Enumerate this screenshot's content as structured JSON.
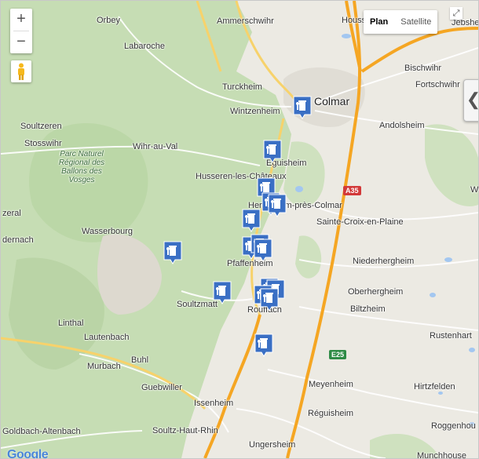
{
  "controls": {
    "zoom_in": "+",
    "zoom_out": "−",
    "map_types": [
      "Plan",
      "Satellite"
    ],
    "active_map_type": "Plan",
    "expand": "❮",
    "fullscreen": "⤢"
  },
  "colors": {
    "forest": "#c6ddb4",
    "plain": "#eceae3",
    "motorway": "#f5a623",
    "marker": "#3a6fc4"
  },
  "labels": {
    "houssen": "Houss",
    "jebsheim": "Jebshei",
    "orbey": "Orbey",
    "ammerschwihr": "Ammerschwihr",
    "labaroche": "Labaroche",
    "bischwihr": "Bischwihr",
    "fortschwihr": "Fortschwihr",
    "turckheim": "Turckheim",
    "colmar": "Colmar",
    "wintzenheim": "Wintzenheim",
    "andolsheim": "Andolsheim",
    "soultzeren": "Soultzeren",
    "stosswihr": "Stosswihr",
    "wihr": "Wihr-au-Val",
    "park": "Parc Naturel Régional des Ballons des Vosges",
    "eguisheim": "Eguisheim",
    "husseren": "Husseren-les-Châteaux",
    "herrlisheim": "Herrlisheim-près-Colmar",
    "a35": "A35",
    "zeral": "zeral",
    "sainte_croix": "Sainte-Croix-en-Plaine",
    "dernach": "dernach",
    "wasserbourg": "Wasserbourg",
    "pfaffenheim": "Pfaffenheim",
    "niederhergheim": "Niederhergheim",
    "oberhergheim": "Oberhergheim",
    "soultzmatt": "Soultzmatt",
    "rouffach": "Rouffach",
    "biltzheim": "Biltzheim",
    "linthal": "Linthal",
    "lautenbach": "Lautenbach",
    "rustenhart": "Rustenhart",
    "e25": "E25",
    "buhl": "Buhl",
    "murbach": "Murbach",
    "meyenheim": "Meyenheim",
    "hirtzfelden": "Hirtzfelden",
    "guebwiller": "Guebwiller",
    "issenheim": "Issenheim",
    "reguisheim": "Réguisheim",
    "roggenhou": "Roggenhou",
    "soultz": "Soultz-Haut-Rhin",
    "goldbach": "Goldbach-Altenbach",
    "ungersheim": "Ungersheim",
    "munchhouse": "Munchhouse",
    "w": "W"
  },
  "markers_count_label": "recycling-point",
  "logo": "Google"
}
